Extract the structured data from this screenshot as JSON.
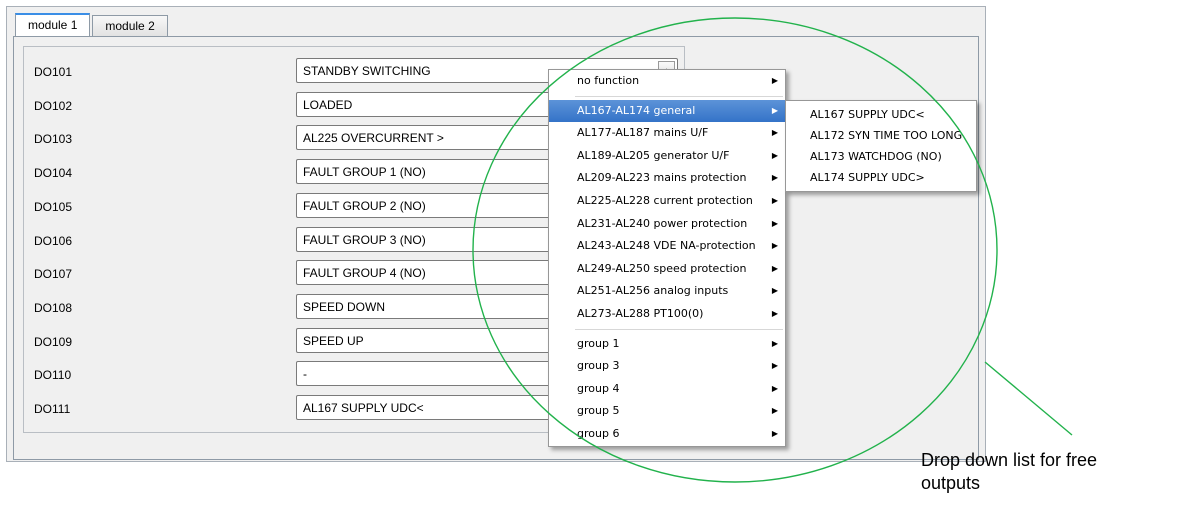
{
  "tabs": [
    {
      "label": "module 1",
      "active": true
    },
    {
      "label": "module 2",
      "active": false
    }
  ],
  "rows": [
    {
      "label": "DO101",
      "value": "STANDBY SWITCHING"
    },
    {
      "label": "DO102",
      "value": "LOADED"
    },
    {
      "label": "DO103",
      "value": "AL225 OVERCURRENT >"
    },
    {
      "label": "DO104",
      "value": "FAULT GROUP 1 (NO)"
    },
    {
      "label": "DO105",
      "value": "FAULT GROUP 2 (NO)"
    },
    {
      "label": "DO106",
      "value": "FAULT GROUP 3 (NO)"
    },
    {
      "label": "DO107",
      "value": "FAULT GROUP 4 (NO)"
    },
    {
      "label": "DO108",
      "value": "SPEED DOWN"
    },
    {
      "label": "DO109",
      "value": "SPEED UP"
    },
    {
      "label": "DO110",
      "value": "-"
    },
    {
      "label": "DO111",
      "value": "AL167 SUPPLY UDC<"
    }
  ],
  "dropdown_menu": {
    "items": [
      {
        "label": "no function",
        "highlighted": false
      },
      {
        "separator": true
      },
      {
        "label": "AL167-AL174 general",
        "highlighted": true
      },
      {
        "label": "AL177-AL187 mains U/F",
        "highlighted": false
      },
      {
        "label": "AL189-AL205 generator U/F",
        "highlighted": false
      },
      {
        "label": "AL209-AL223 mains protection",
        "highlighted": false
      },
      {
        "label": "AL225-AL228 current protection",
        "highlighted": false
      },
      {
        "label": "AL231-AL240 power protection",
        "highlighted": false
      },
      {
        "label": "AL243-AL248 VDE NA-protection",
        "highlighted": false
      },
      {
        "label": "AL249-AL250 speed protection",
        "highlighted": false
      },
      {
        "label": "AL251-AL256 analog inputs",
        "highlighted": false
      },
      {
        "label": "AL273-AL288 PT100(0)",
        "highlighted": false
      },
      {
        "separator": true
      },
      {
        "label": "group 1",
        "highlighted": false
      },
      {
        "label": "group 3",
        "highlighted": false
      },
      {
        "label": "group 4",
        "highlighted": false
      },
      {
        "label": "group 5",
        "highlighted": false
      },
      {
        "label": "group 6",
        "highlighted": false
      }
    ]
  },
  "submenu": {
    "items": [
      "AL167 SUPPLY UDC<",
      "AL172 SYN TIME TOO LONG",
      "AL173 WATCHDOG (NO)",
      "AL174  SUPPLY UDC>"
    ]
  },
  "annotation": {
    "line1": "Drop down list for free",
    "line2": "outputs",
    "color": "#22b24c"
  },
  "icons": {
    "submenu_arrow": "chevron-right-icon",
    "combo_arrow": "triangle-up-icon"
  }
}
